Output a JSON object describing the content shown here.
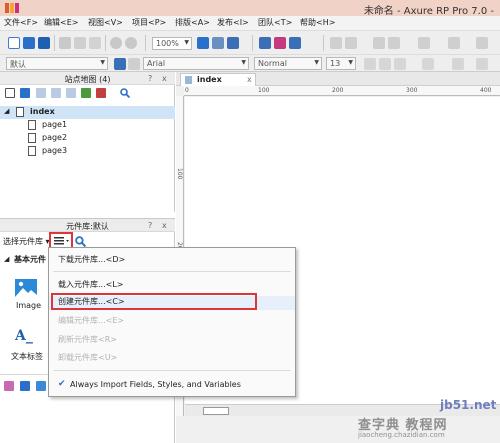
{
  "window": {
    "title": "未命名 - Axure RP Pro 7.0 -"
  },
  "menubar": {
    "items": [
      "文件<F>",
      "编辑<E>",
      "视图<V>",
      "项目<P>",
      "排版<A>",
      "发布<I>",
      "团队<T>",
      "帮助<H>"
    ]
  },
  "toolbar": {
    "zoom": "100%",
    "style_select": "默认",
    "font_family": "Arial",
    "font_weight": "Normal",
    "font_size": "13"
  },
  "sitemap": {
    "title": "站点地图 (4)",
    "help": "?",
    "close": "x",
    "pages": [
      {
        "label": "index",
        "level": 0,
        "selected": true
      },
      {
        "label": "page1",
        "level": 1
      },
      {
        "label": "page2",
        "level": 1
      },
      {
        "label": "page3",
        "level": 1
      }
    ]
  },
  "library": {
    "title": "元件库:默认",
    "select_label": "选择元件库",
    "category": "基本元件",
    "widgets": [
      {
        "label": "Image",
        "icon": "image-widget-icon"
      },
      {
        "label": "文本标签",
        "icon": "text-label-widget-icon"
      }
    ]
  },
  "document": {
    "tab": "index",
    "ruler_h": [
      "0",
      "100",
      "200",
      "300",
      "400"
    ],
    "ruler_v": [
      "100",
      "200"
    ]
  },
  "dropdown": {
    "items": [
      {
        "label": "下载元件库...<D>",
        "enabled": true
      },
      {
        "label": "载入元件库...<L>",
        "enabled": true
      },
      {
        "label": "创建元件库...<C>",
        "enabled": true,
        "highlighted": true
      },
      {
        "label": "编辑元件库...<E>",
        "enabled": false
      },
      {
        "label": "刷新元件库<R>",
        "enabled": false
      },
      {
        "label": "卸载元件库<U>",
        "enabled": false
      },
      {
        "label": "Always Import Fields, Styles, and Variables",
        "enabled": true,
        "checked": true
      }
    ]
  },
  "watermark": {
    "brand": "查字典 教程网",
    "site": "jb51.net",
    "url": "jiaocheng.chazidian.com"
  },
  "colors": {
    "titlebar": "#f1d2c7",
    "highlight_box": "#d9383a",
    "selection": "#cfe4f7",
    "accent_blue": "#2a6fc9"
  }
}
